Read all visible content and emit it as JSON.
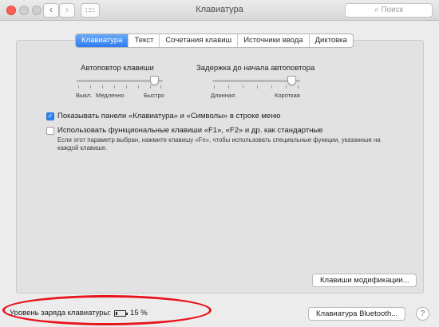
{
  "window": {
    "title": "Клавиатура",
    "search_placeholder": "Поиск",
    "icons": {
      "back": "chevron-left-icon",
      "forward": "chevron-right-icon",
      "grid": "grid-icon",
      "search": "search-icon"
    }
  },
  "tabs": [
    {
      "label": "Клавиатура",
      "selected": true
    },
    {
      "label": "Текст",
      "selected": false
    },
    {
      "label": "Сочетания клавиш",
      "selected": false
    },
    {
      "label": "Источники ввода",
      "selected": false
    },
    {
      "label": "Диктовка",
      "selected": false
    }
  ],
  "key_repeat": {
    "label": "Автоповтор клавиши",
    "min_label": "Выкл.",
    "slow_label": "Медленно",
    "max_label": "Быстро",
    "value": 0.95
  },
  "repeat_delay": {
    "label": "Задержка до начала автоповтора",
    "min_label": "Длинная",
    "max_label": "Короткая",
    "value": 0.95
  },
  "options": {
    "show_viewers": {
      "label": "Показывать панели «Клавиатура» и «Символы» в строке меню",
      "checked": true
    },
    "fn_keys": {
      "label": "Использовать функциональные клавиши «F1», «F2» и др. как стандартные",
      "checked": false,
      "note": "Если этот параметр выбран, нажмите клавишу «Fn», чтобы использовать специальные функции, указанные на каждой клавише."
    }
  },
  "buttons": {
    "modifier_keys": "Клавиши модификации...",
    "bluetooth_keyboard": "Клавиатура Bluetooth...",
    "help": "?"
  },
  "battery": {
    "label": "Уровень заряда клавиатуры:",
    "percent_text": "15 %",
    "level": 0.15
  },
  "colors": {
    "accent": "#2d7cf0",
    "highlight": "#e8141b",
    "close": "#fc5f57"
  }
}
